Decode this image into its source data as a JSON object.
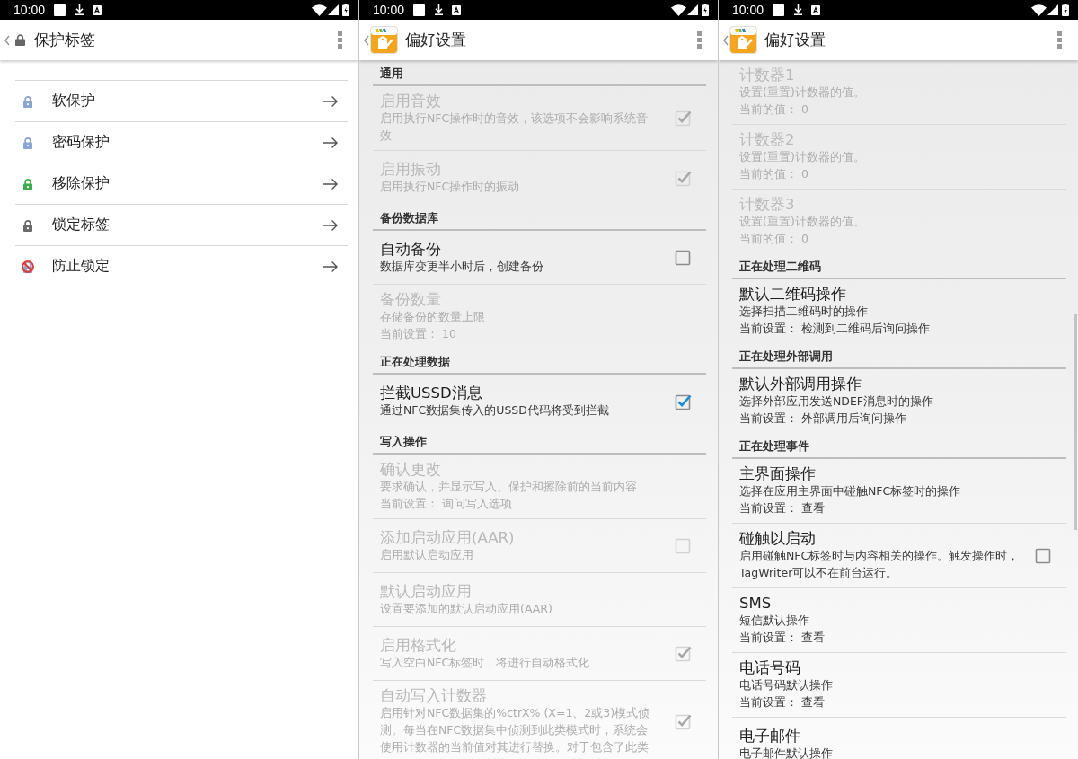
{
  "screens": [
    {
      "kind": "lock_menu",
      "status_bar": {
        "time": "10:00"
      },
      "toolbar": {
        "title": "保护标签"
      },
      "items": [
        {
          "label": "软保护",
          "kind": "lock",
          "color": "#8aa6d6"
        },
        {
          "label": "密码保护",
          "kind": "lock",
          "color": "#8aa6d6"
        },
        {
          "label": "移除保护",
          "kind": "lock",
          "color": "#3dae4c"
        },
        {
          "label": "锁定标签",
          "kind": "lock",
          "color": "#6b6b6b"
        },
        {
          "label": "防止锁定",
          "kind": "prohibit",
          "color": "#e53935"
        }
      ]
    },
    {
      "kind": "preferences",
      "status_bar": {
        "time": "10:00"
      },
      "toolbar": {
        "title": "偏好设置"
      },
      "sections": [
        {
          "kind": "category",
          "title": "通用"
        },
        {
          "kind": "item",
          "title": "启用音效",
          "summary": "启用执行NFC操作时的音效，该选项不会影响系统音效",
          "enabled": false,
          "checkbox": {
            "checked": true
          }
        },
        {
          "kind": "item",
          "title": "启用振动",
          "summary": "启用执行NFC操作时的振动",
          "enabled": false,
          "checkbox": {
            "checked": true
          }
        },
        {
          "kind": "category",
          "title": "备份数据库"
        },
        {
          "kind": "item",
          "title": "自动备份",
          "summary": "数据库变更半小时后，创建备份",
          "enabled": true,
          "checkbox": {
            "checked": false
          }
        },
        {
          "kind": "item",
          "title": "备份数量",
          "summary": "存储备份的数量上限",
          "value": "当前设置： 10",
          "enabled": false
        },
        {
          "kind": "category",
          "title": "正在处理数据"
        },
        {
          "kind": "item",
          "title": "拦截USSD消息",
          "summary": "通过NFC数据集传入的USSD代码将受到拦截",
          "enabled": true,
          "checkbox": {
            "checked": true
          }
        },
        {
          "kind": "category",
          "title": "写入操作"
        },
        {
          "kind": "item",
          "title": "确认更改",
          "summary": "要求确认，并显示写入、保护和擦除前的当前内容",
          "value": "当前设置： 询问写入选项",
          "enabled": false
        },
        {
          "kind": "item",
          "title": "添加启动应用(AAR)",
          "summary": "启用默认启动应用",
          "enabled": false,
          "checkbox": {
            "checked": false
          }
        },
        {
          "kind": "item",
          "title": "默认启动应用",
          "summary": "设置要添加的默认启动应用(AAR)",
          "enabled": false
        },
        {
          "kind": "item",
          "title": "启用格式化",
          "summary": "写入空白NFC标签时，将进行自动格式化",
          "enabled": false,
          "checkbox": {
            "checked": true
          }
        },
        {
          "kind": "item",
          "title": "自动写入计数器",
          "summary": "启用针对NFC数据集的%ctrX% (X=1、2或3)模式侦测。每当在NFC数据集中侦测到此类模式时，系统会使用计数器的当前值对其进行替换。对于包含了此类",
          "enabled": false,
          "checkbox": {
            "checked": true
          }
        }
      ]
    },
    {
      "kind": "preferences",
      "status_bar": {
        "time": "10:00"
      },
      "toolbar": {
        "title": "偏好设置"
      },
      "scroll_indicator": true,
      "sections": [
        {
          "kind": "item",
          "title": "计数器1",
          "summary": "设置(重置)计数器的值。",
          "value": "当前的值： 0",
          "enabled": false
        },
        {
          "kind": "item",
          "title": "计数器2",
          "summary": "设置(重置)计数器的值。",
          "value": "当前的值： 0",
          "enabled": false
        },
        {
          "kind": "item",
          "title": "计数器3",
          "summary": "设置(重置)计数器的值。",
          "value": "当前的值： 0",
          "enabled": false
        },
        {
          "kind": "category",
          "title": "正在处理二维码"
        },
        {
          "kind": "item",
          "title": "默认二维码操作",
          "summary": "选择扫描二维码时的操作",
          "value": "当前设置： 检测到二维码后询问操作",
          "enabled": true
        },
        {
          "kind": "category",
          "title": "正在处理外部调用"
        },
        {
          "kind": "item",
          "title": "默认外部调用操作",
          "summary": "选择外部应用发送NDEF消息时的操作",
          "value": "当前设置： 外部调用后询问操作",
          "enabled": true
        },
        {
          "kind": "category",
          "title": "正在处理事件"
        },
        {
          "kind": "item",
          "title": "主界面操作",
          "summary": "选择在应用主界面中碰触NFC标签时的操作",
          "value": "当前设置： 查看",
          "enabled": true
        },
        {
          "kind": "item",
          "title": "碰触以启动",
          "summary": "启用碰触NFC标签时与内容相关的操作。触发操作时，TagWriter可以不在前台运行。",
          "enabled": true,
          "checkbox": {
            "checked": false
          }
        },
        {
          "kind": "item",
          "title": "SMS",
          "summary": "短信默认操作",
          "value": "当前设置： 查看",
          "enabled": true
        },
        {
          "kind": "item",
          "title": "电话号码",
          "summary": "电话号码默认操作",
          "value": "当前设置： 查看",
          "enabled": true
        },
        {
          "kind": "item",
          "title": "电子邮件",
          "summary": "电子邮件默认操作",
          "enabled": true
        }
      ]
    }
  ]
}
